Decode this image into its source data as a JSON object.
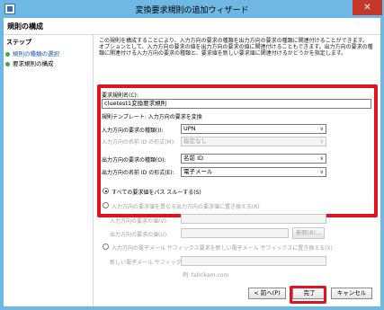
{
  "window": {
    "title": "変換要求規則の追加ウィザード",
    "close_glyph": "✕"
  },
  "header": {
    "title": "規則の構成"
  },
  "steps": {
    "label": "ステップ",
    "items": [
      {
        "label": "規則の種類の選択"
      },
      {
        "label": "要求規則の構成"
      }
    ]
  },
  "description": "この規則を構成することにより、入力方向の要求の種類を出力方向の要求の種類に関連付けることができます。オプションとして、入力方向の要求の値を出力方向の要求の値に関連付けることもできます。出力方向の要求の種類に関連付ける入力方向の要求の種類と、要求値を新しい要求値に関連付けるかどうかを指定します。",
  "form": {
    "rule_name_label": "要求規則名(C):",
    "rule_name_value": "cluetest1変換要求規則",
    "template_text": "規則テンプレート: 入力方向の要求を変換",
    "incoming_type_label": "入力方向の要求の種類(I):",
    "incoming_type_value": "UPN",
    "incoming_format_label": "入力方向の名前 ID の形式(M):",
    "incoming_format_value": "指定なし",
    "outgoing_type_label": "出力方向の要求の種類(O):",
    "outgoing_type_value": "名前 ID",
    "outgoing_format_label": "出力方向の名前 ID の形式(E):",
    "outgoing_format_value": "電子メール",
    "passthrough_label": "すべての要求値をパス スルーする(S)",
    "replace_value_label": "入力方向の要求値を異なる出力方向の要求値に置き換える(R)",
    "incoming_value_label": "入力方向の要求の値(V):",
    "outgoing_value_label": "出力方向の要求の値(U):",
    "browse_label": "参照(B)...",
    "replace_suffix_label": "入力方向の電子メール サフィックス要求を新しい電子メール サフィックスに置き換える(X)",
    "new_suffix_label": "新しい電子メール サフィックス(W):",
    "example_text": "例: fabrikam.com"
  },
  "footer": {
    "back_label": "< 前へ(P)",
    "finish_label": "完了",
    "cancel_label": "キャンセル"
  }
}
